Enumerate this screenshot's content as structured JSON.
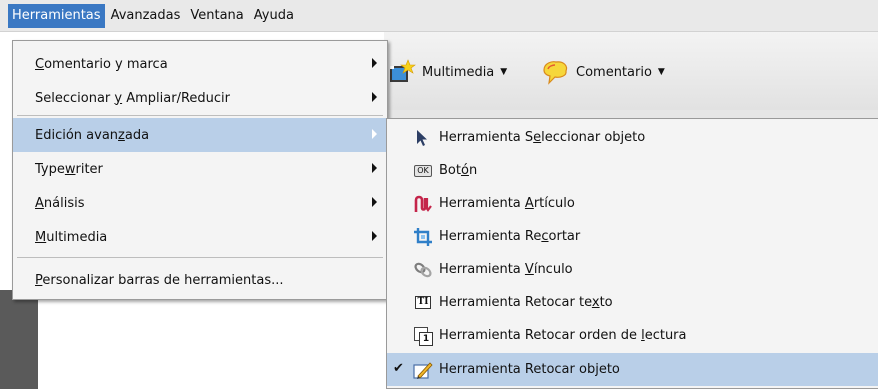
{
  "menubar": {
    "items": [
      {
        "label": "Herramientas",
        "active": true
      },
      {
        "label": "Avanzadas",
        "active": false
      },
      {
        "label": "Ventana",
        "active": false
      },
      {
        "label": "Ayuda",
        "active": false
      }
    ]
  },
  "toolbar": {
    "multimedia_label": "Multimedia",
    "comentario_label": "Comentario"
  },
  "menu": {
    "items": [
      {
        "pre": "",
        "u": "C",
        "post": "omentario y marca",
        "submenu": true
      },
      {
        "pre": "Seleccionar ",
        "u": "y",
        "post": " Ampliar/Reducir",
        "submenu": true
      },
      {
        "pre": "Edición avan",
        "u": "z",
        "post": "ada",
        "submenu": true,
        "highlighted": true
      },
      {
        "pre": "Type",
        "u": "w",
        "post": "riter",
        "submenu": true
      },
      {
        "pre": "",
        "u": "A",
        "post": "nálisis",
        "submenu": true
      },
      {
        "pre": "",
        "u": "M",
        "post": "ultimedia",
        "submenu": true
      },
      {
        "pre": "",
        "u": "P",
        "post": "ersonalizar barras de herramientas...",
        "submenu": false
      }
    ]
  },
  "submenu": {
    "items": [
      {
        "icon": "pointer-icon",
        "pre": "Herramienta S",
        "u": "e",
        "post": "leccionar objeto"
      },
      {
        "icon": "ok-button-icon",
        "pre": "Bot",
        "u": "ó",
        "post": "n"
      },
      {
        "icon": "article-icon",
        "pre": "Herramienta ",
        "u": "A",
        "post": "rtículo"
      },
      {
        "icon": "crop-icon",
        "pre": "Herramienta Re",
        "u": "c",
        "post": "ortar"
      },
      {
        "icon": "link-icon",
        "pre": "Herramienta ",
        "u": "V",
        "post": "ínculo"
      },
      {
        "icon": "touchup-text-icon",
        "pre": "Herramienta Retocar te",
        "u": "x",
        "post": "to"
      },
      {
        "icon": "reading-order-icon",
        "pre": "Herramienta Retocar orden de ",
        "u": "l",
        "post": "ectura"
      },
      {
        "icon": "touchup-object-icon",
        "pre": "Herramienta Retocar objeto",
        "u": "",
        "post": "",
        "checked": true,
        "highlighted": true
      }
    ],
    "ok_icon_text": "OK",
    "ti_icon_text": "TI",
    "num_icon_text": "1",
    "check_glyph": "✔"
  }
}
